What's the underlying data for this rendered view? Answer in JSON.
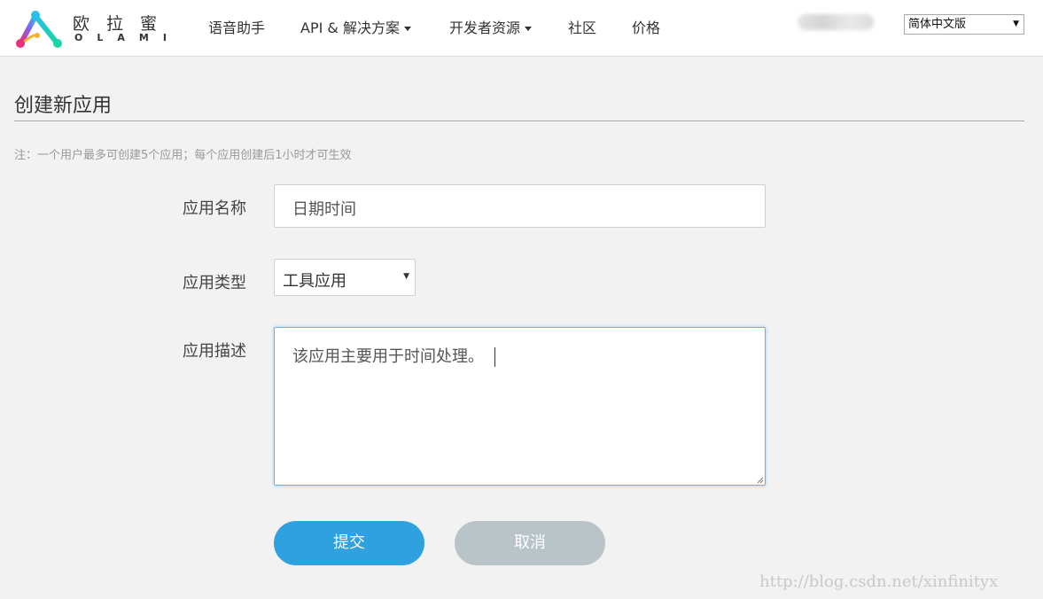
{
  "brand": {
    "name_cn": "欧拉蜜",
    "name_en": "OLAMI"
  },
  "nav": {
    "voice_assistant": "语音助手",
    "api_solutions": "API & 解决方案",
    "developer_resources": "开发者资源",
    "community": "社区",
    "pricing": "价格"
  },
  "language_select": {
    "value": "简体中文版"
  },
  "page": {
    "title": "创建新应用",
    "note": "注：一个用户最多可创建5个应用；每个应用创建后1小时才可生效"
  },
  "form": {
    "name_label": "应用名称",
    "name_value": "日期时间",
    "type_label": "应用类型",
    "type_value": "工具应用",
    "desc_label": "应用描述",
    "desc_value": "该应用主要用于时间处理。",
    "submit_label": "提交",
    "cancel_label": "取消"
  },
  "watermark": "http://blog.csdn.net/xinfinityx",
  "colors": {
    "primary": "#2ea1de",
    "cancel": "#b9c4c9",
    "background": "#f2f2f2"
  }
}
